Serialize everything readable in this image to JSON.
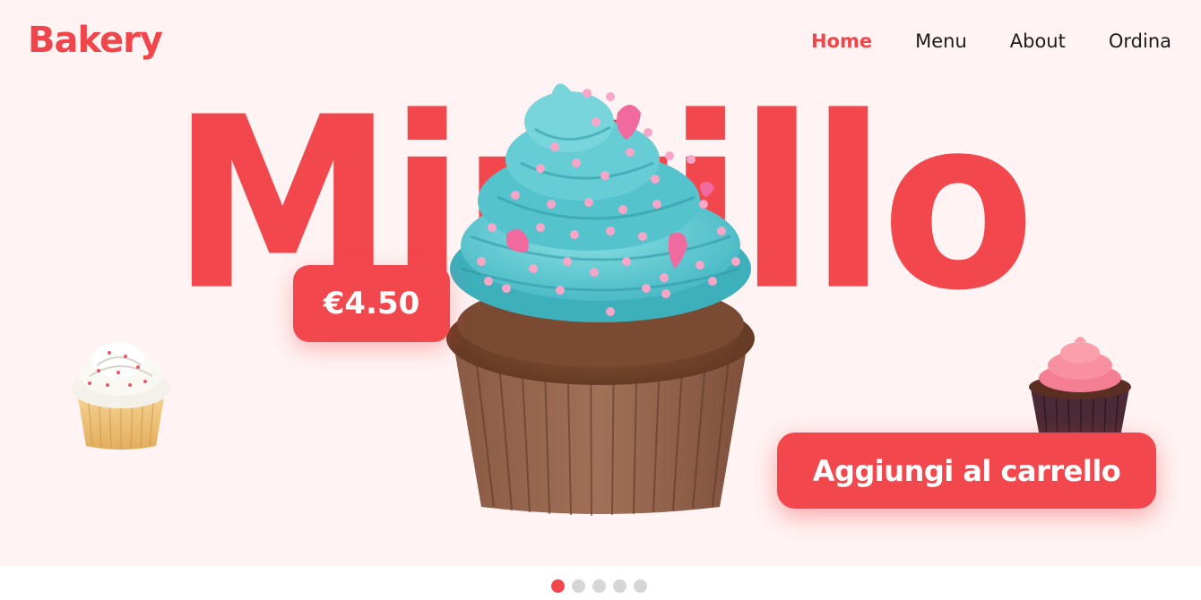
{
  "brand": {
    "logo_text": "Bakery"
  },
  "nav": {
    "items": [
      {
        "label": "Home",
        "active": true
      },
      {
        "label": "Menu",
        "active": false
      },
      {
        "label": "About",
        "active": false
      },
      {
        "label": "Ordina",
        "active": false
      }
    ]
  },
  "hero": {
    "word": "Mirtillo",
    "price": "€4.50",
    "cta_label": "Aggiungi al carrello"
  },
  "carousel": {
    "slide_count": 5,
    "active_index": 0
  },
  "colors": {
    "accent": "#f2474c",
    "background": "#fff3f3",
    "frosting_main": "#5cc9d2",
    "sprinkles": "#f58bb6",
    "cake": "#7a4a32"
  }
}
